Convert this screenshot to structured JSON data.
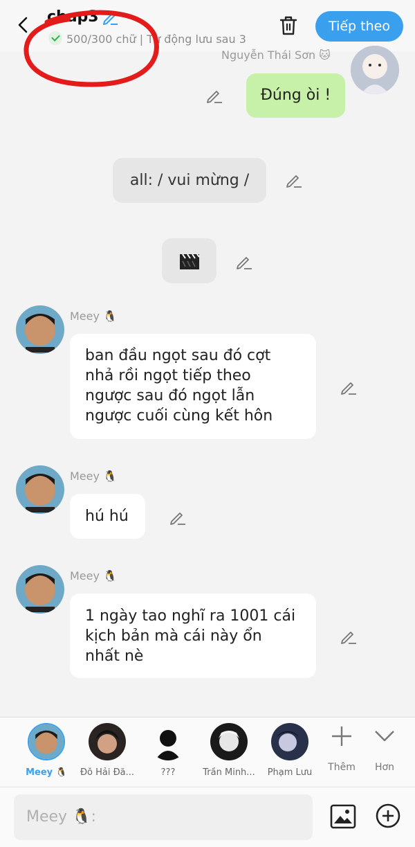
{
  "header": {
    "title": "chap3",
    "subtitle": "500/300 chữ | Tự động lưu sau 3",
    "next_label": "Tiếp theo"
  },
  "messages": [
    {
      "sender": "Nguyễn Thái Sơn 🐱",
      "text": "Đúng òi !"
    },
    {
      "text": "all: / vui mừng /"
    },
    {
      "text": "🎬"
    },
    {
      "sender": "Meey 🐧",
      "text": "ban đầu ngọt sau đó cợt nhả rồi ngọt tiếp theo ngược sau đó ngọt lẫn ngược cuối cùng kết hôn"
    },
    {
      "sender": "Meey 🐧",
      "text": "hú hú"
    },
    {
      "sender": "Meey 🐧",
      "text": "1 ngày tao nghĩ ra 1001 cái kịch bản mà cái này ổn nhất nè"
    }
  ],
  "characters": [
    {
      "name": "Meey 🐧"
    },
    {
      "name": "Đỗ Hải Đă..."
    },
    {
      "name": "???"
    },
    {
      "name": "Trần Minh..."
    },
    {
      "name": "Phạm Lưu"
    }
  ],
  "tools": {
    "add_label": "Thêm",
    "more_label": "Hơn"
  },
  "input": {
    "placeholder": "Meey 🐧:"
  },
  "colors": {
    "accent": "#3aa0ee",
    "bubble_green": "#c7f0a8",
    "annotation_red": "#e31b1b"
  }
}
